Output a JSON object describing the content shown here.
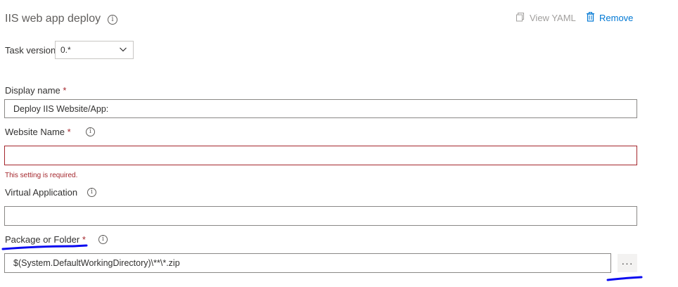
{
  "header": {
    "title": "IIS web app deploy",
    "view_yaml_label": "View YAML",
    "remove_label": "Remove"
  },
  "task_version": {
    "label": "Task version",
    "value": "0.*"
  },
  "fields": {
    "display_name": {
      "label": "Display name",
      "required_mark": "*",
      "value": "Deploy IIS Website/App:"
    },
    "website_name": {
      "label": "Website Name",
      "required_mark": "*",
      "value": "",
      "error": "This setting is required."
    },
    "virtual_application": {
      "label": "Virtual Application",
      "value": ""
    },
    "package_or_folder": {
      "label": "Package or Folder",
      "required_mark": "*",
      "value": "$(System.DefaultWorkingDirectory)\\**\\*.zip",
      "more_label": "···"
    }
  },
  "colors": {
    "accent": "#0078d4",
    "error": "#a4262c",
    "annotation": "#0a0af0"
  },
  "icons": [
    "info-icon",
    "copy-icon",
    "trash-icon",
    "chevron-down-icon",
    "more-icon"
  ]
}
